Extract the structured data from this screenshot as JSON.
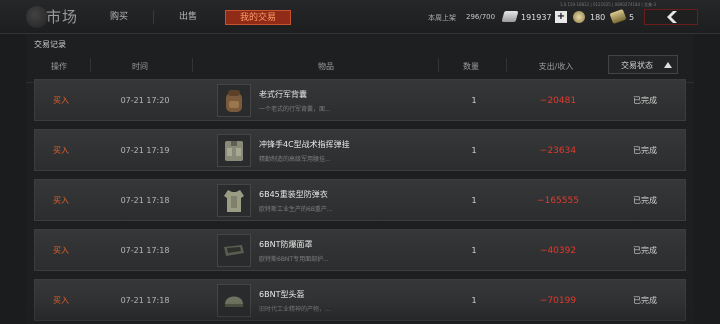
{
  "header": {
    "title": "市场",
    "tabs": [
      {
        "label": "购买",
        "active": false
      },
      {
        "label": "出售",
        "active": false
      },
      {
        "label": "我的交易",
        "active": true
      }
    ],
    "version_text": "1.0.159.16812 | 0121625 | 0800274184 | 北美-3",
    "listing_label": "本周上架",
    "listing_value": "296/700",
    "currency_bills": "191937",
    "currency_coins": "180",
    "currency_tokens": "5",
    "icons": {
      "back": "chevron-left-icon",
      "plus": "plus-icon",
      "logo": "globe-icon"
    },
    "accent_color": "#8f2b16"
  },
  "panel": {
    "title": "交易记录",
    "columns": {
      "op": "操作",
      "time": "时间",
      "item": "物品",
      "qty": "数量",
      "pay": "支出/收入",
      "status": "交易状态"
    },
    "sort_indicator": "ascending",
    "rows": [
      {
        "op": "买入",
        "time": "07-21 17:20",
        "name": "老式行军背囊",
        "desc": "一个老式的行军背囊，面...",
        "qty": "1",
        "pay": "−20481",
        "status": "已完成",
        "icon": "backpack-icon"
      },
      {
        "op": "买入",
        "time": "07-21 17:19",
        "name": "冲锋手4C型战术指挥弹挂",
        "desc": "精勤制造的高级军用腰挂...",
        "qty": "1",
        "pay": "−23634",
        "status": "已完成",
        "icon": "chest-rig-icon"
      },
      {
        "op": "买入",
        "time": "07-21 17:18",
        "name": "6B45重装型防弹衣",
        "desc": "欧特斯工业生产的6B重产...",
        "qty": "1",
        "pay": "−165555",
        "status": "已完成",
        "icon": "body-armor-icon"
      },
      {
        "op": "买入",
        "time": "07-21 17:18",
        "name": "6BNT防爆面罩",
        "desc": "欧特斯6BNT专用面部护...",
        "qty": "1",
        "pay": "−40392",
        "status": "已完成",
        "icon": "face-shield-icon"
      },
      {
        "op": "买入",
        "time": "07-21 17:18",
        "name": "6BNT型头盔",
        "desc": "旧时代工业精神的产物，...",
        "qty": "1",
        "pay": "−70199",
        "status": "已完成",
        "icon": "helmet-icon"
      }
    ]
  }
}
